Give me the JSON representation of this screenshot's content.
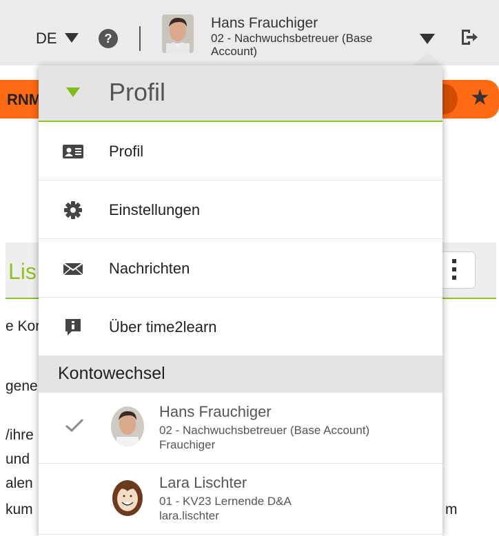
{
  "header": {
    "language": "DE",
    "help_symbol": "?",
    "user_name": "Hans Frauchiger",
    "user_role": "02 - Nachwuchsbetreuer (Base Account)"
  },
  "background": {
    "orange_partial_text": "RNM",
    "panel_partial_title": "Lis",
    "text_lines": [
      "e Kor",
      "gene",
      "/ihre",
      "und",
      "alen",
      "kum",
      "m"
    ]
  },
  "dropdown": {
    "title": "Profil",
    "menu_items": [
      {
        "label": "Profil",
        "icon": "id-card-icon"
      },
      {
        "label": "Einstellungen",
        "icon": "gear-icon"
      },
      {
        "label": "Nachrichten",
        "icon": "envelope-icon"
      },
      {
        "label": "Über time2learn",
        "icon": "info-icon"
      }
    ],
    "section_title": "Kontowechsel",
    "accounts": [
      {
        "name": "Hans Frauchiger",
        "role": "02 - Nachwuchsbetreuer (Base Account)",
        "username": "Frauchiger",
        "active": true
      },
      {
        "name": "Lara Lischter",
        "role": "01 - KV23 Lernende D&A",
        "username": "lara.lischter",
        "active": false
      }
    ]
  },
  "colors": {
    "accent_green": "#8dc21f",
    "brand_orange": "#ff6a13",
    "header_bg": "#ebebeb"
  }
}
